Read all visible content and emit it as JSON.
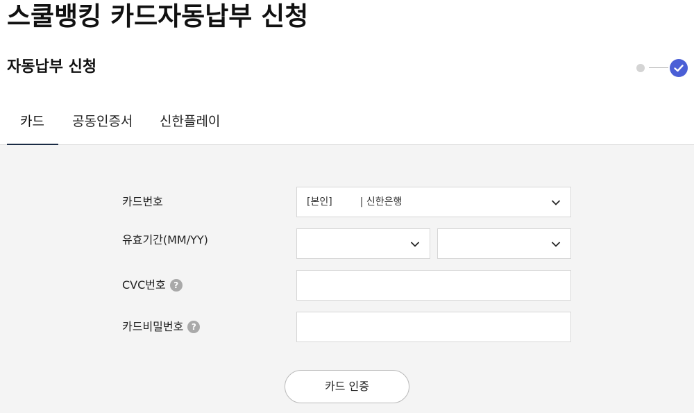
{
  "page": {
    "title": "스쿨뱅킹 카드자동납부 신청",
    "section_title": "자동납부 신청"
  },
  "tabs": [
    {
      "label": "카드",
      "active": true
    },
    {
      "label": "공동인증서",
      "active": false
    },
    {
      "label": "신한플레이",
      "active": false
    }
  ],
  "form": {
    "card_number": {
      "label": "카드번호",
      "selected": "[본인]         | 신한은행"
    },
    "expiry": {
      "label": "유효기간(MM/YY)",
      "month_selected": "",
      "year_selected": ""
    },
    "cvc": {
      "label": "CVC번호",
      "help": "?",
      "value": ""
    },
    "card_password": {
      "label": "카드비밀번호",
      "help": "?",
      "value": ""
    },
    "submit_label": "카드 인증"
  },
  "colors": {
    "accent": "#4a5fd6",
    "tab_underline": "#1a2b44",
    "form_background": "#f4f4f4"
  },
  "icons": {
    "step_pending": "dot-icon",
    "step_done": "check-circle-icon",
    "dropdown": "chevron-down-icon",
    "help": "question-icon"
  }
}
